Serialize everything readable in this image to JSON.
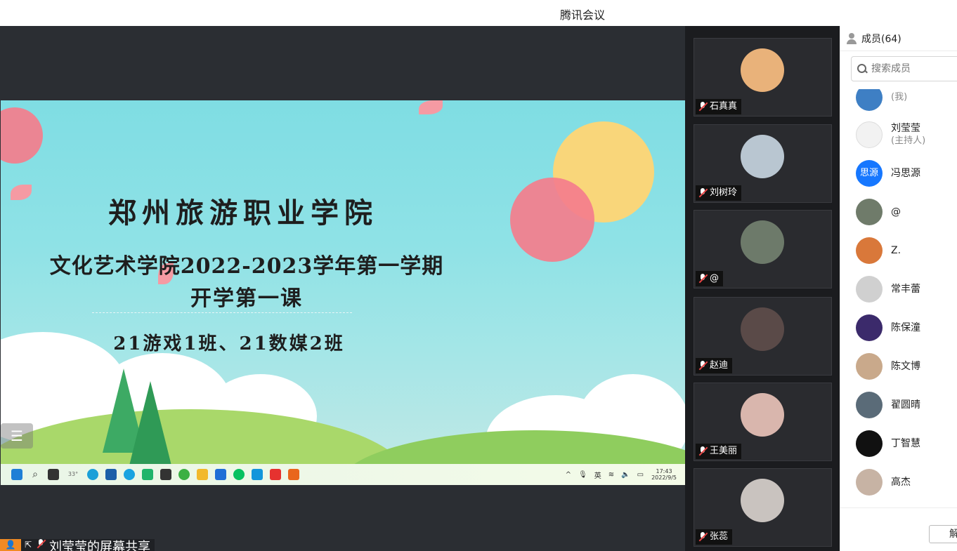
{
  "window": {
    "title": "腾讯会议"
  },
  "slide": {
    "line1": "郑州旅游职业学院",
    "line2": "文化艺术学院2022-2023学年第一学期",
    "line3": "开学第一课",
    "line4": "21游戏1班、21数媒2班",
    "menu_glyph": "☰"
  },
  "taskbar": {
    "weather": "33°",
    "tray_chevron": "^",
    "lang": "英",
    "time": "17:43",
    "date": "2022/9/5"
  },
  "share_label": "刘莹莹的屏幕共享",
  "tiles": [
    {
      "name": "石真真",
      "color": "#e9b27a"
    },
    {
      "name": "刘树玲",
      "color": "#b9c6d1"
    },
    {
      "name": "@",
      "color": "#6d7a6a"
    },
    {
      "name": "赵迪",
      "color": "#5a4a48"
    },
    {
      "name": "王美丽",
      "color": "#d9b6ad"
    },
    {
      "name": "张蕊",
      "color": "#c9c3bf"
    }
  ],
  "panel": {
    "title": "成员(64)",
    "search_placeholder": "搜索成员",
    "members": [
      {
        "name": "",
        "role": "(我)",
        "avatar_text": "",
        "color": "#3e7fc4"
      },
      {
        "name": "刘莹莹",
        "role": "(主持人)",
        "avatar_text": "",
        "color": "#f2f2f2"
      },
      {
        "name": "冯思源",
        "role": "",
        "avatar_text": "思源",
        "color": "#1677ff"
      },
      {
        "name": "@",
        "role": "",
        "avatar_text": "",
        "color": "#6f7b6a"
      },
      {
        "name": "Z.",
        "role": "",
        "avatar_text": "",
        "color": "#d9783a"
      },
      {
        "name": "常丰蕾",
        "role": "",
        "avatar_text": "",
        "color": "#d0d0d0"
      },
      {
        "name": "陈保潼",
        "role": "",
        "avatar_text": "",
        "color": "#3b2a6b"
      },
      {
        "name": "陈文博",
        "role": "",
        "avatar_text": "",
        "color": "#c9a98b"
      },
      {
        "name": "翟圆晴",
        "role": "",
        "avatar_text": "",
        "color": "#5a6b78"
      },
      {
        "name": "丁智慧",
        "role": "",
        "avatar_text": "",
        "color": "#111111"
      },
      {
        "name": "高杰",
        "role": "",
        "avatar_text": "",
        "color": "#c7b3a4"
      }
    ],
    "footer_button": "解"
  }
}
